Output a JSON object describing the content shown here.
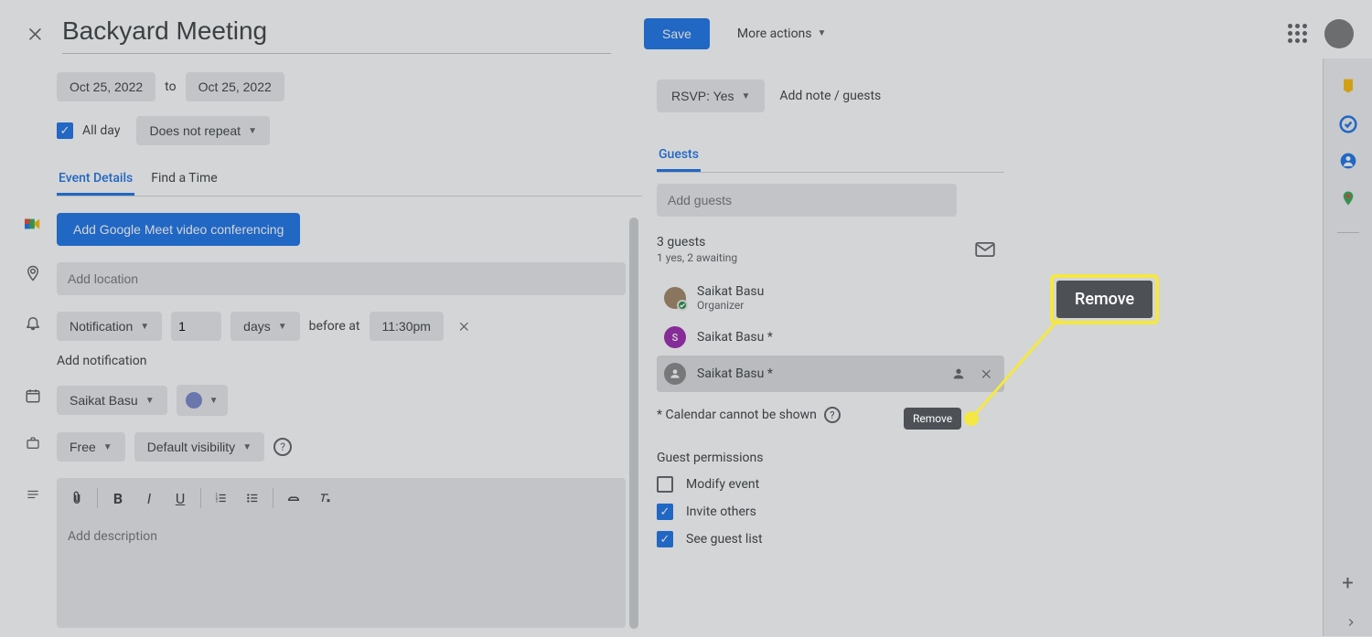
{
  "header": {
    "event_title": "Backyard Meeting",
    "save_label": "Save",
    "more_actions_label": "More actions"
  },
  "dates": {
    "start": "Oct 25, 2022",
    "to_label": "to",
    "end": "Oct 25, 2022",
    "all_day_label": "All day",
    "repeat_label": "Does not repeat"
  },
  "rsvp": {
    "button_label": "RSVP: Yes",
    "add_note_label": "Add note / guests"
  },
  "tabs_left": {
    "details": "Event Details",
    "find_time": "Find a Time"
  },
  "tabs_right": {
    "guests": "Guests"
  },
  "meet": {
    "add_label": "Add Google Meet video conferencing"
  },
  "location": {
    "placeholder": "Add location"
  },
  "notification": {
    "type": "Notification",
    "count": "1",
    "unit": "days",
    "before_at": "before at",
    "time": "11:30pm",
    "add_label": "Add notification"
  },
  "calendar": {
    "owner": "Saikat Basu"
  },
  "availability": {
    "status": "Free",
    "visibility": "Default visibility"
  },
  "description": {
    "placeholder": "Add description"
  },
  "guests_panel": {
    "input_placeholder": "Add guests",
    "summary": "3 guests",
    "summary_sub": "1 yes, 2 awaiting",
    "list": [
      {
        "name": "Saikat Basu",
        "sub": "Organizer",
        "suffix": ""
      },
      {
        "name": "Saikat Basu",
        "sub": "",
        "suffix": " *"
      },
      {
        "name": "Saikat Basu",
        "sub": "",
        "suffix": " *"
      }
    ],
    "cal_note": "* Calendar cannot be shown"
  },
  "tooltip": {
    "remove": "Remove"
  },
  "callout": {
    "label": "Remove"
  },
  "permissions": {
    "title": "Guest permissions",
    "modify": "Modify event",
    "invite": "Invite others",
    "see_list": "See guest list"
  }
}
